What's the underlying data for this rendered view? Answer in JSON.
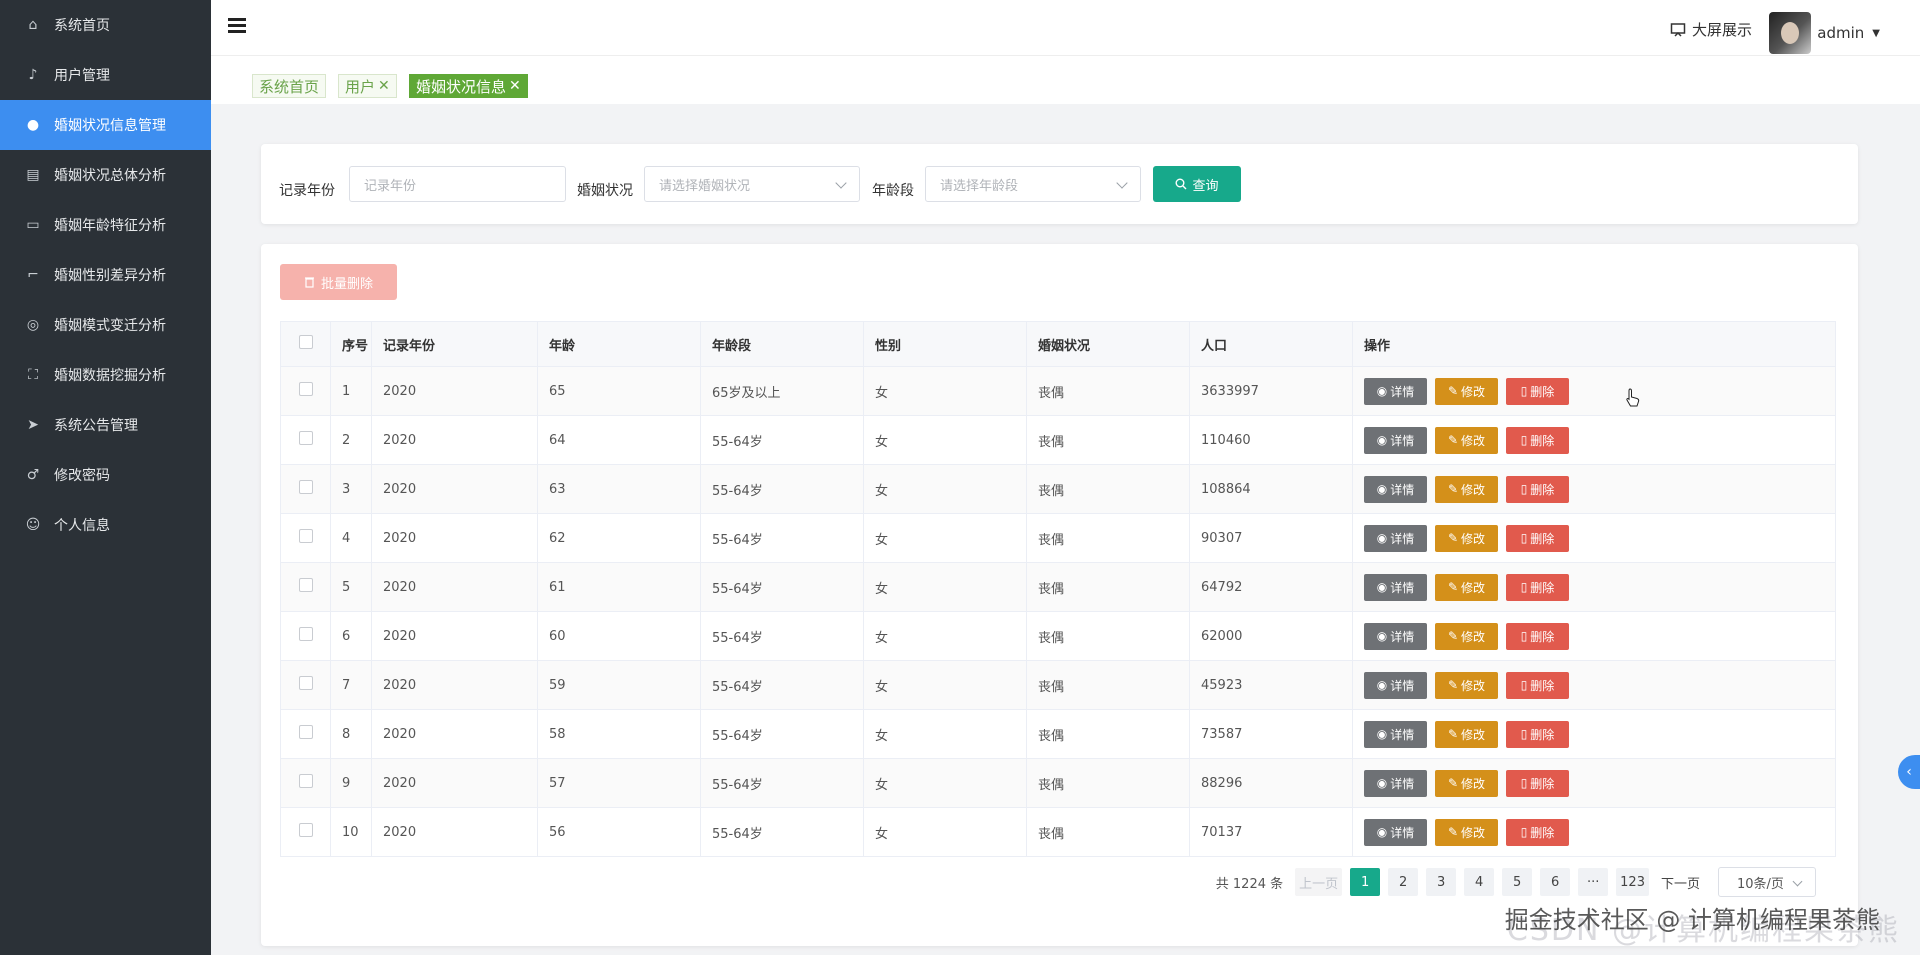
{
  "sidebar": {
    "items": [
      {
        "label": "系统首页",
        "icon": "home-icon",
        "glyph": "⌂"
      },
      {
        "label": "用户管理",
        "icon": "mic-icon",
        "glyph": "♪"
      },
      {
        "label": "婚姻状况信息管理",
        "icon": "bulb-icon",
        "glyph": "●",
        "active": true
      },
      {
        "label": "婚姻状况总体分析",
        "icon": "briefcase-icon",
        "glyph": "▤"
      },
      {
        "label": "婚姻年龄特征分析",
        "icon": "chat-icon",
        "glyph": "▭"
      },
      {
        "label": "婚姻性别差异分析",
        "icon": "crop-icon",
        "glyph": "⌐"
      },
      {
        "label": "婚姻模式变迁分析",
        "icon": "target-icon",
        "glyph": "◎"
      },
      {
        "label": "婚姻数据挖掘分析",
        "icon": "fullscreen-icon",
        "glyph": "⛶"
      },
      {
        "label": "系统公告管理",
        "icon": "send-icon",
        "glyph": "➤"
      },
      {
        "label": "修改密码",
        "icon": "key-icon",
        "glyph": "♂"
      },
      {
        "label": "个人信息",
        "icon": "user-icon",
        "glyph": "☺"
      }
    ]
  },
  "header": {
    "screen_label": "大屏展示",
    "user_name": "admin"
  },
  "tags": [
    {
      "label": "系统首页",
      "closable": false
    },
    {
      "label": "用户",
      "closable": true
    },
    {
      "label": "婚姻状况信息",
      "closable": true,
      "active": true
    }
  ],
  "search": {
    "year_label": "记录年份",
    "year_placeholder": "记录年份",
    "status_label": "婚姻状况",
    "status_placeholder": "请选择婚姻状况",
    "age_label": "年龄段",
    "age_placeholder": "请选择年龄段",
    "query_label": "查询"
  },
  "toolbar": {
    "batch_delete_label": "批量删除"
  },
  "table": {
    "columns": [
      "序号",
      "记录年份",
      "年龄",
      "年龄段",
      "性别",
      "婚姻状况",
      "人口",
      "操作"
    ],
    "rows": [
      {
        "no": "1",
        "year": "2020",
        "age": "65",
        "age_group": "65岁及以上",
        "gender": "女",
        "status": "丧偶",
        "population": "3633997"
      },
      {
        "no": "2",
        "year": "2020",
        "age": "64",
        "age_group": "55-64岁",
        "gender": "女",
        "status": "丧偶",
        "population": "110460"
      },
      {
        "no": "3",
        "year": "2020",
        "age": "63",
        "age_group": "55-64岁",
        "gender": "女",
        "status": "丧偶",
        "population": "108864"
      },
      {
        "no": "4",
        "year": "2020",
        "age": "62",
        "age_group": "55-64岁",
        "gender": "女",
        "status": "丧偶",
        "population": "90307"
      },
      {
        "no": "5",
        "year": "2020",
        "age": "61",
        "age_group": "55-64岁",
        "gender": "女",
        "status": "丧偶",
        "population": "64792"
      },
      {
        "no": "6",
        "year": "2020",
        "age": "60",
        "age_group": "55-64岁",
        "gender": "女",
        "status": "丧偶",
        "population": "62000"
      },
      {
        "no": "7",
        "year": "2020",
        "age": "59",
        "age_group": "55-64岁",
        "gender": "女",
        "status": "丧偶",
        "population": "45923"
      },
      {
        "no": "8",
        "year": "2020",
        "age": "58",
        "age_group": "55-64岁",
        "gender": "女",
        "status": "丧偶",
        "population": "73587"
      },
      {
        "no": "9",
        "year": "2020",
        "age": "57",
        "age_group": "55-64岁",
        "gender": "女",
        "status": "丧偶",
        "population": "88296"
      },
      {
        "no": "10",
        "year": "2020",
        "age": "56",
        "age_group": "55-64岁",
        "gender": "女",
        "status": "丧偶",
        "population": "70137"
      }
    ],
    "actions": {
      "view": "详情",
      "edit": "修改",
      "delete": "删除"
    }
  },
  "pagination": {
    "total_text": "共 1224 条",
    "prev_label": "上一页",
    "next_label": "下一页",
    "pages": [
      "1",
      "2",
      "3",
      "4",
      "5",
      "6",
      "···",
      "123"
    ],
    "current": "1",
    "page_size": "10条/页"
  },
  "watermark": "掘金技术社区 @ 计算机编程果茶熊",
  "watermark_faint": "CSDN @计算机编程果茶熊",
  "colors": {
    "sidebar_bg": "#2b3137",
    "sidebar_active": "#3d8ef0",
    "primary": "#17a98b",
    "tag_active": "#5fa836",
    "view_btn": "#6e7175",
    "edit_btn": "#d4901a",
    "delete_btn": "#e15a4d"
  }
}
